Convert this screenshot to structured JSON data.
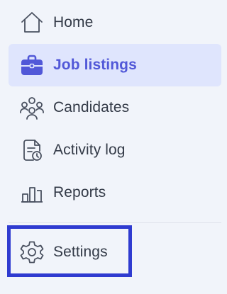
{
  "nav": {
    "items": [
      {
        "label": "Home",
        "icon": "home-icon",
        "active": false
      },
      {
        "label": "Job listings",
        "icon": "briefcase-icon",
        "active": true
      },
      {
        "label": "Candidates",
        "icon": "users-icon",
        "active": false
      },
      {
        "label": "Activity log",
        "icon": "document-clock-icon",
        "active": false
      },
      {
        "label": "Reports",
        "icon": "bar-chart-icon",
        "active": false
      }
    ],
    "settings": {
      "label": "Settings",
      "icon": "gear-icon"
    }
  },
  "colors": {
    "background": "#f1f4fa",
    "active_background": "#dfe5fd",
    "accent": "#5158d8",
    "text": "#333a47",
    "icon": "#4a5160",
    "focus_ring": "#2f3bd0"
  }
}
